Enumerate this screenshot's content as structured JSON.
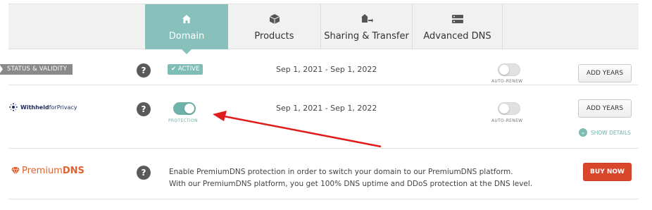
{
  "tabs": [
    {
      "label": "Domain",
      "icon": "home-icon",
      "active": true
    },
    {
      "label": "Products",
      "icon": "box-icon",
      "active": false
    },
    {
      "label": "Sharing & Transfer",
      "icon": "share-transfer-icon",
      "active": false
    },
    {
      "label": "Advanced DNS",
      "icon": "dns-server-icon",
      "active": false
    }
  ],
  "status_row": {
    "label": "STATUS & VALIDITY",
    "badge": "ACTIVE",
    "dates": "Sep 1, 2021 - Sep 1, 2022",
    "auto_renew_caption": "AUTO-RENEW",
    "auto_renew_on": false,
    "button": "ADD YEARS"
  },
  "privacy_row": {
    "logo_part1": "Withheld",
    "logo_part2": "forPrivacy",
    "protection_caption": "PROTECTION",
    "protection_on": true,
    "dates": "Sep 1, 2021 - Sep 1, 2022",
    "auto_renew_caption": "AUTO-RENEW",
    "auto_renew_on": false,
    "button": "ADD YEARS",
    "show_details": "SHOW DETAILS"
  },
  "premium_row": {
    "logo_part1": "Premium",
    "logo_part2": "DNS",
    "description_line1": "Enable PremiumDNS protection in order to switch your domain to our PremiumDNS platform.",
    "description_line2": "With our PremiumDNS platform, you get 100% DNS uptime and DDoS protection at the DNS level.",
    "button": "BUY NOW"
  },
  "help_glyph": "?",
  "colors": {
    "accent_teal": "#88c1bc",
    "buy_red": "#d9472b",
    "annotation_arrow": "#e01b1b"
  }
}
